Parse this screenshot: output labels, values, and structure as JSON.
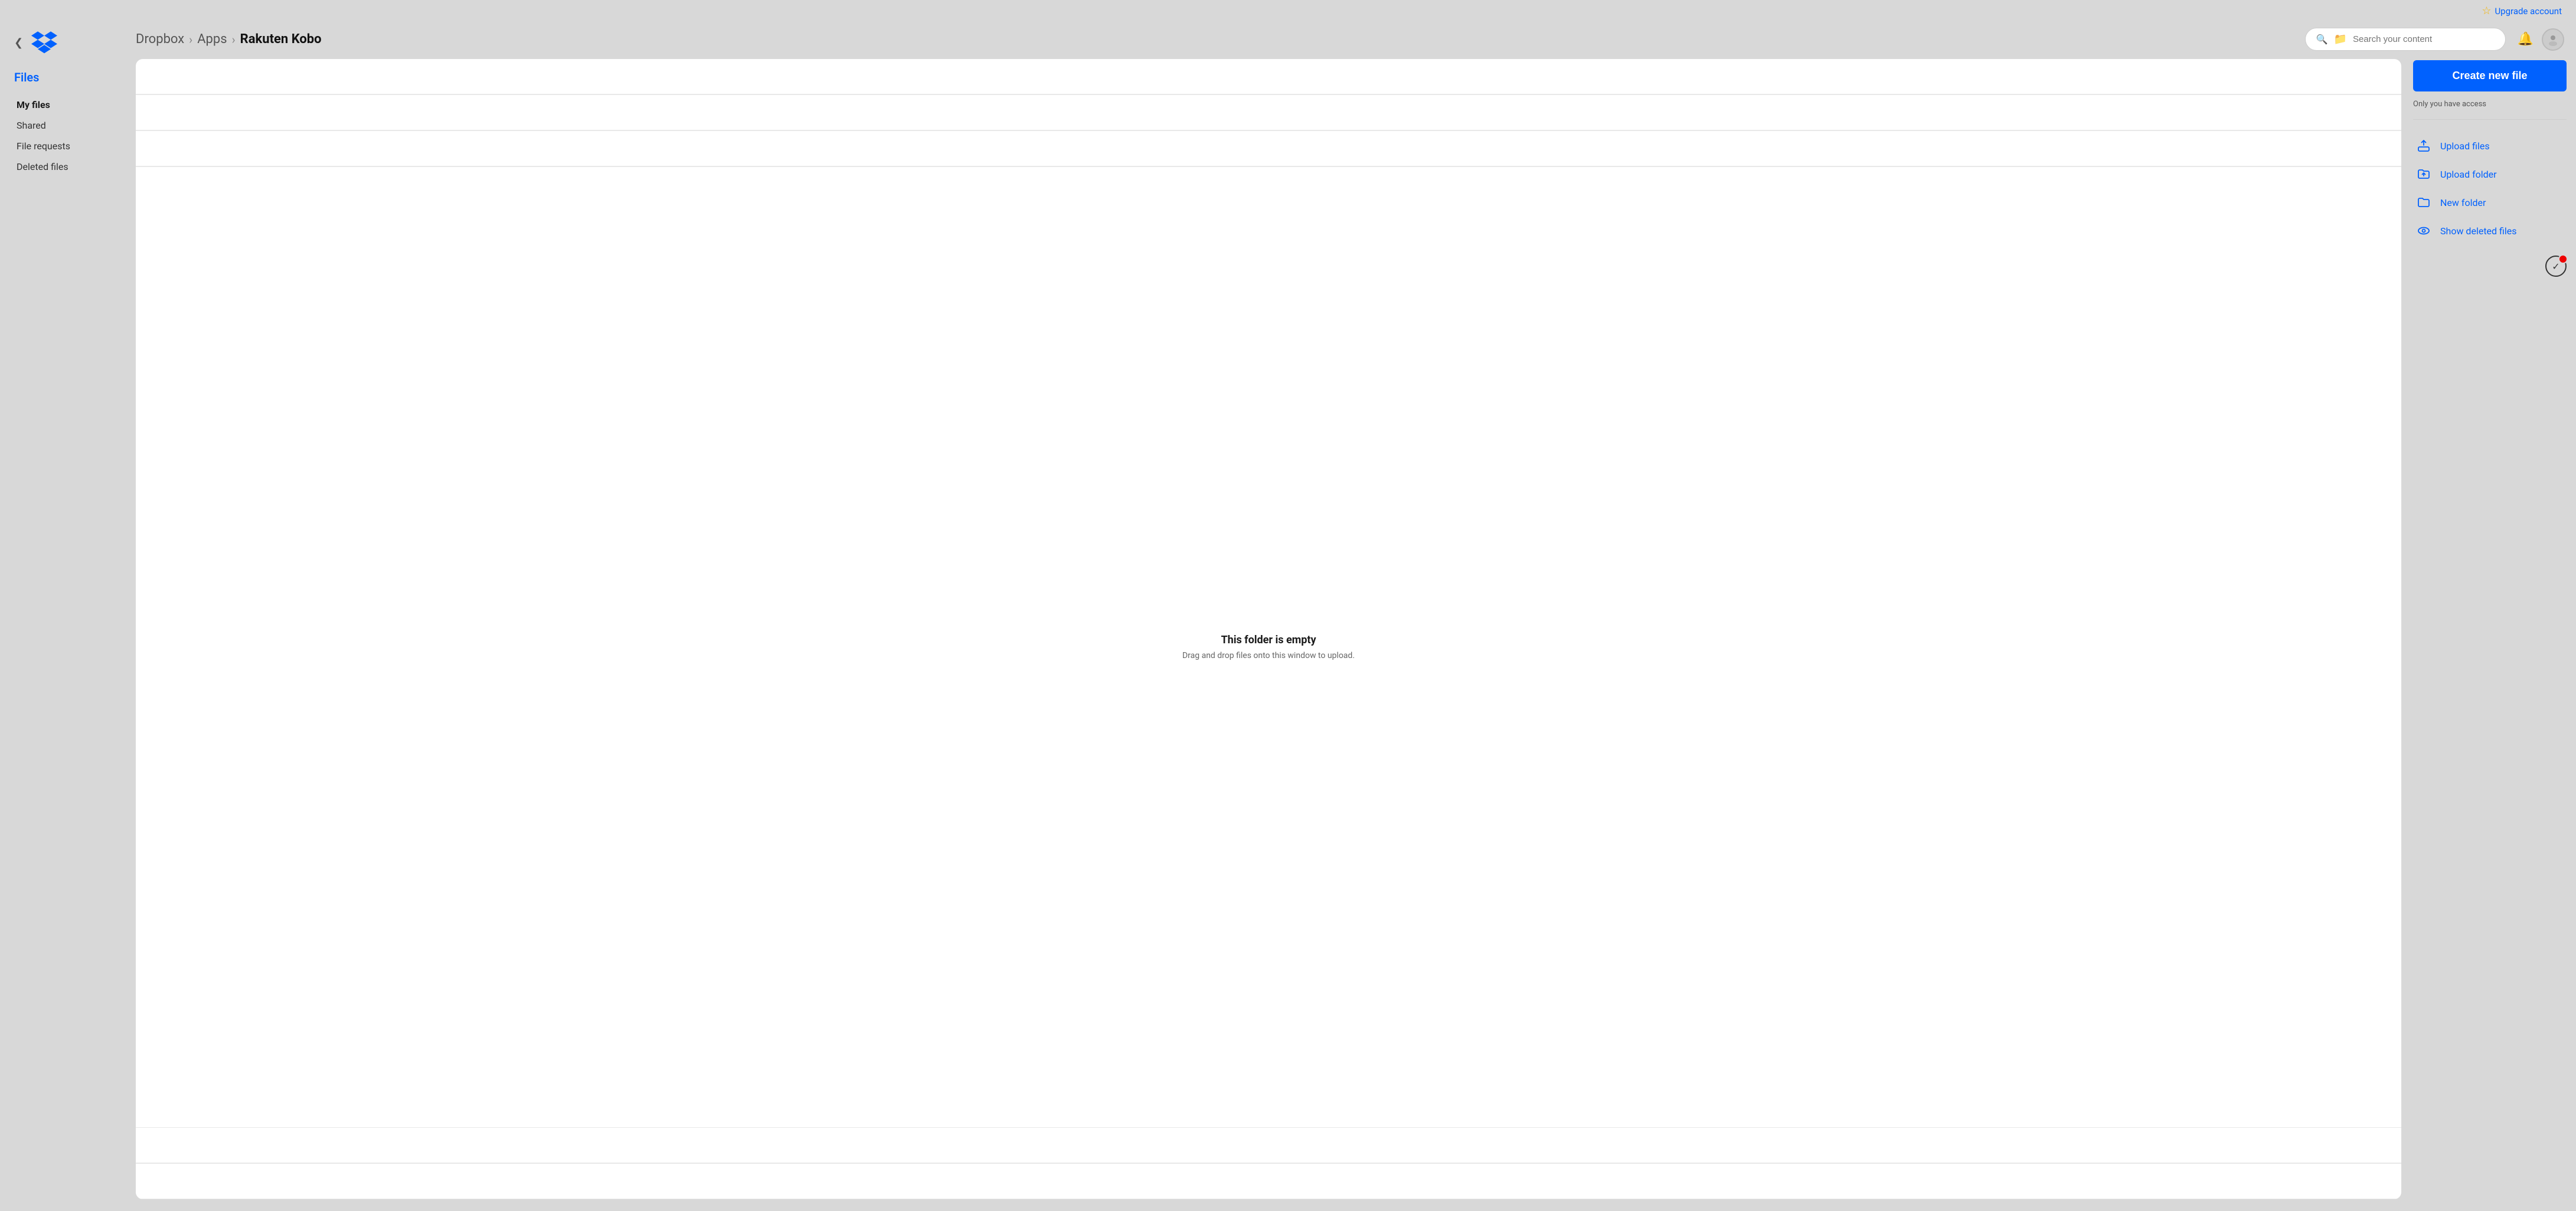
{
  "topbar": {
    "upgrade_label": "Upgrade account"
  },
  "sidebar": {
    "section_title": "Files",
    "nav_items": [
      {
        "id": "my-files",
        "label": "My files",
        "active": true
      },
      {
        "id": "shared",
        "label": "Shared",
        "active": false
      },
      {
        "id": "file-requests",
        "label": "File requests",
        "active": false
      },
      {
        "id": "deleted-files",
        "label": "Deleted files",
        "active": false
      }
    ]
  },
  "breadcrumb": {
    "parts": [
      {
        "label": "Dropbox"
      },
      {
        "label": "Apps"
      },
      {
        "label": "Rakuten Kobo"
      }
    ]
  },
  "search": {
    "placeholder": "Search your content"
  },
  "main_panel": {
    "empty_title": "This folder is empty",
    "empty_subtitle": "Drag and drop files onto this window to upload."
  },
  "right_panel": {
    "create_button_label": "Create new file",
    "access_info": "Only you have access",
    "actions": [
      {
        "id": "upload-files",
        "label": "Upload files",
        "icon": "upload-file"
      },
      {
        "id": "upload-folder",
        "label": "Upload folder",
        "icon": "upload-folder"
      },
      {
        "id": "new-folder",
        "label": "New folder",
        "icon": "new-folder"
      },
      {
        "id": "show-deleted",
        "label": "Show deleted files",
        "icon": "eye"
      }
    ]
  }
}
